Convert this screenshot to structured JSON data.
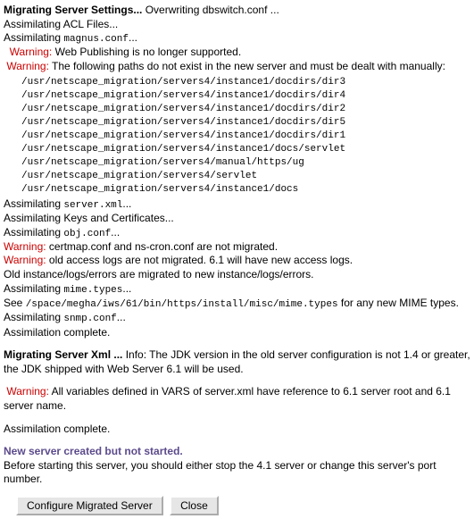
{
  "header1": {
    "title": "Migrating Server Settings...",
    "info": "Overwriting dbswitch.conf ..."
  },
  "lines": {
    "acl": "Assimilating ACL Files...",
    "assim_prefix": "Assimilating ",
    "magnus": "magnus.conf",
    "ellipsis": "...",
    "warn_label": "Warning:",
    "warn_webpub": " Web Publishing is no longer supported.",
    "warn_paths": " The following paths do not exist in the new server and must be dealt with manually:",
    "serverxml": "server.xml",
    "keys": "Assimilating Keys and Certificates...",
    "objconf": "obj.conf",
    "warn_certmap": " certmap.conf and ns-cron.conf are not migrated.",
    "warn_access": " old access logs are not migrated. 6.1 will have new access logs.",
    "oldinst": "Old instance/logs/errors are migrated to new instance/logs/errors.",
    "mimetypes": "mime.types",
    "see_prefix": "  See ",
    "see_path": "/space/megha/iws/61/bin/https/install/misc/mime.types",
    "see_suffix": " for any new MIME types.",
    "snmp": "snmp.conf",
    "assim_complete": "Assimilation complete."
  },
  "paths": [
    "/usr/netscape_migration/servers4/instance1/docdirs/dir3",
    "/usr/netscape_migration/servers4/instance1/docdirs/dir4",
    "/usr/netscape_migration/servers4/instance1/docdirs/dir2",
    "/usr/netscape_migration/servers4/instance1/docdirs/dir5",
    "/usr/netscape_migration/servers4/instance1/docdirs/dir1",
    "/usr/netscape_migration/servers4/instance1/docs/servlet",
    "/usr/netscape_migration/servers4/manual/https/ug",
    "/usr/netscape_migration/servers4/servlet",
    "/usr/netscape_migration/servers4/instance1/docs"
  ],
  "header2": {
    "title": "Migrating Server Xml ...",
    "info": " Info: The JDK version in the old server configuration is not 1.4 or greater, the JDK shipped with Web Server 6.1 will be used."
  },
  "warn_vars": " All variables defined in VARS of server.xml have reference to 6.1 server root and 6.1 server name.",
  "newserver": "New server created but not started.",
  "before_start": "Before starting this server, you should either stop the 4.1 server or change this server's port number.",
  "buttons": {
    "configure": "Configure Migrated Server",
    "close": "Close"
  }
}
